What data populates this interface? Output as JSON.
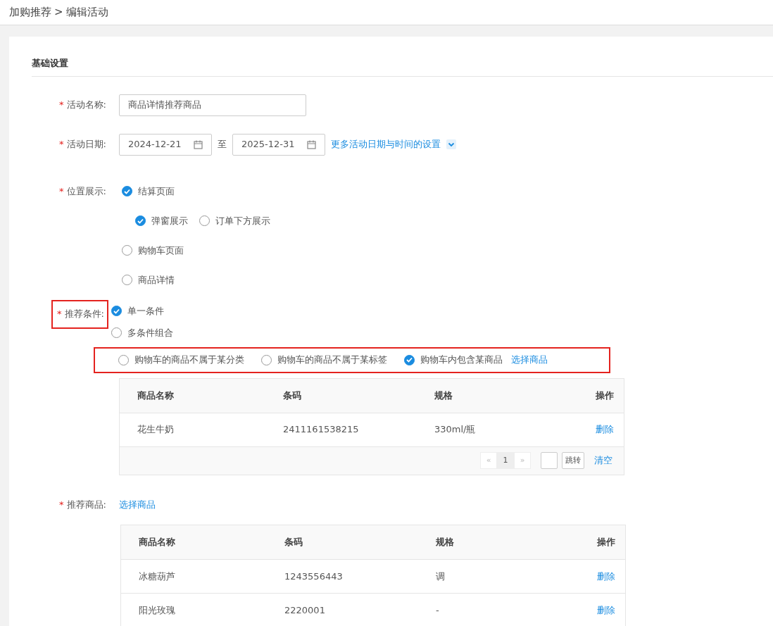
{
  "breadcrumb": {
    "parent": "加购推荐",
    "separator": ">",
    "current": "编辑活动"
  },
  "section_title": "基础设置",
  "name_field": {
    "required_mark": "*",
    "label": "活动名称:",
    "value": "商品详情推荐商品"
  },
  "date_field": {
    "required_mark": "*",
    "label": "活动日期:",
    "start": "2024-12-21",
    "separator": "至",
    "end": "2025-12-31",
    "more_link": "更多活动日期与时间的设置"
  },
  "position_field": {
    "required_mark": "*",
    "label": "位置展示:",
    "options": [
      {
        "label": "结算页面",
        "checked": true,
        "children": [
          {
            "label": "弹窗展示",
            "checked": true
          },
          {
            "label": "订单下方展示",
            "checked": false
          }
        ]
      },
      {
        "label": "购物车页面",
        "checked": false
      },
      {
        "label": "商品详情",
        "checked": false
      }
    ]
  },
  "condition_field": {
    "required_mark": "*",
    "label": "推荐条件:",
    "highlighted": true,
    "options": [
      {
        "label": "单一条件",
        "selected": true
      },
      {
        "label": "多条件组合",
        "selected": false
      }
    ],
    "sub_options_highlighted": true,
    "sub_options": [
      {
        "label": "购物车的商品不属于某分类",
        "selected": false
      },
      {
        "label": "购物车的商品不属于某标签",
        "selected": false
      },
      {
        "label": "购物车内包含某商品",
        "selected": true
      }
    ],
    "select_link": "选择商品",
    "table": {
      "columns": [
        "商品名称",
        "条码",
        "规格",
        "操作"
      ],
      "rows": [
        {
          "name": "花生牛奶",
          "barcode": "2411161538215",
          "spec": "330ml/瓶",
          "action": "删除"
        }
      ]
    },
    "pagination": {
      "prev": "«",
      "pages": [
        {
          "label": "1",
          "selected": true
        }
      ],
      "next": "»",
      "prev_disabled": true,
      "next_disabled": true,
      "jump_button": "跳转",
      "clear_link": "清空"
    }
  },
  "recommend_field": {
    "required_mark": "*",
    "label": "推荐商品:",
    "select_link": "选择商品",
    "table": {
      "columns": [
        "商品名称",
        "条码",
        "规格",
        "操作"
      ],
      "rows": [
        {
          "name": "冰糖葫芦",
          "barcode": "1243556443",
          "spec": "调",
          "action": "删除"
        },
        {
          "name": "阳光玫瑰",
          "barcode": "2220001",
          "spec": "-",
          "action": "删除"
        }
      ]
    }
  }
}
